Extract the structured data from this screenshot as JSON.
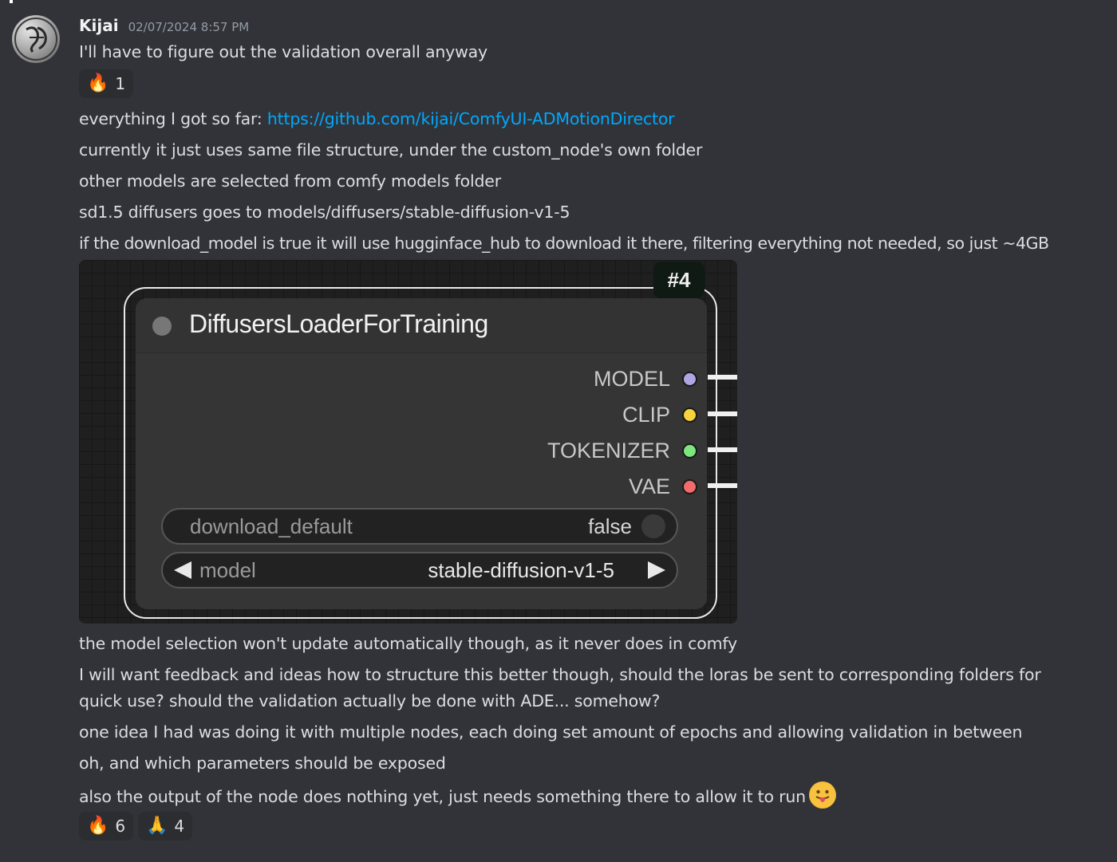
{
  "message": {
    "username": "Kijai",
    "timestamp": "02/07/2024 8:57 PM",
    "lines": {
      "l1": "I'll have to figure out the validation overall anyway",
      "l2_prefix": "everything I got so far: ",
      "l2_link": "https://github.com/kijai/ComfyUI-ADMotionDirector",
      "l3": "currently it just uses same file structure, under the custom_node's own folder",
      "l4": "other models are selected from comfy models folder",
      "l5": "sd1.5 diffusers goes to models/diffusers/stable-diffusion-v1-5",
      "l6": "if the download_model is true it will use hugginface_hub to download it there, filtering everything not needed, so just ~4GB",
      "l7": "the model selection won't update automatically though, as it never does in comfy",
      "l8a": "I will want feedback and ideas how to structure this better though, should the loras be sent to corresponding folders for",
      "l8b": "quick use? should the validation actually be done with ADE... somehow?",
      "l9": "one idea I had was doing it with multiple nodes, each doing set amount of epochs and allowing validation in between",
      "l10": "oh, and which parameters should be exposed",
      "l11": "also the output of the node does nothing yet, just needs something there to allow it to run"
    },
    "reactions_1": [
      {
        "emoji": "🔥",
        "count": "1"
      }
    ],
    "reactions_2": [
      {
        "emoji": "🔥",
        "count": "6"
      },
      {
        "emoji": "🙏",
        "count": "4"
      }
    ],
    "inline_emoji": "stuck-out-tongue-emoji"
  },
  "node": {
    "badge": "#4",
    "title": "DiffusersLoaderForTraining",
    "outputs": [
      {
        "label": "MODEL",
        "color": "#b1a4e2"
      },
      {
        "label": "CLIP",
        "color": "#f5d33c"
      },
      {
        "label": "TOKENIZER",
        "color": "#7ee67e"
      },
      {
        "label": "VAE",
        "color": "#f36b6b"
      }
    ],
    "widgets": {
      "download_default": {
        "label": "download_default",
        "value": "false"
      },
      "model": {
        "label": "model",
        "value": "stable-diffusion-v1-5"
      }
    }
  },
  "colors": {
    "background": "#313338",
    "text": "#dbdee1",
    "link": "#00a8fc",
    "reaction_bg": "#2b2d31"
  }
}
